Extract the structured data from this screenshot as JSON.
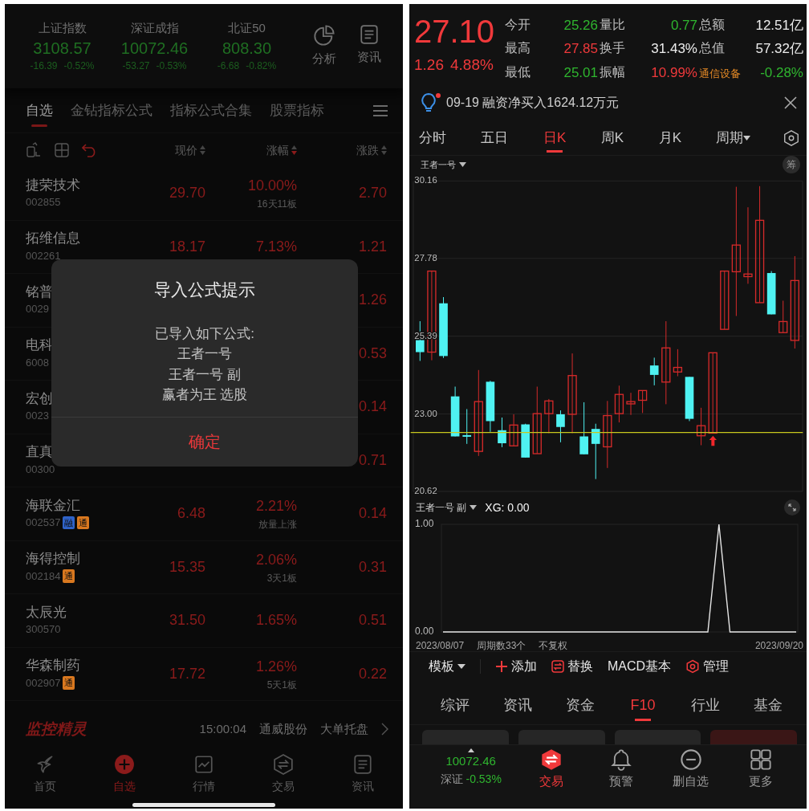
{
  "left_screen": {
    "indices": [
      {
        "name": "上证指数",
        "value": "3108.57",
        "change": "-16.39",
        "percent": "-0.52%"
      },
      {
        "name": "深证成指",
        "value": "10072.46",
        "change": "-53.27",
        "percent": "-0.53%"
      },
      {
        "name": "北证50",
        "value": "808.30",
        "change": "-6.68",
        "percent": "-0.82%"
      }
    ],
    "header_actions": [
      {
        "label": "分析",
        "kind": "pie"
      },
      {
        "label": "资讯",
        "kind": "doc"
      }
    ],
    "tabs": [
      {
        "label": "自选",
        "selected": true
      },
      {
        "label": "金钻指标公式",
        "selected": false
      },
      {
        "label": "指标公式合集",
        "selected": false
      },
      {
        "label": "股票指标",
        "selected": false
      }
    ],
    "columns": [
      {
        "label": "现价",
        "sorted": false
      },
      {
        "label": "涨幅",
        "sorted": true
      },
      {
        "label": "涨跌",
        "sorted": false
      }
    ],
    "stocks": [
      {
        "name": "捷荣技术",
        "code": "002855",
        "price": "29.70",
        "percent": "10.00%",
        "note": "16天11板",
        "change": "2.70"
      },
      {
        "name": "拓维信息",
        "code": "002261",
        "price": "18.17",
        "percent": "7.13%",
        "change": "1.21"
      },
      {
        "name": "铭普",
        "code": "0029",
        "change": "1.26"
      },
      {
        "name": "电科",
        "code": "6008",
        "change": "0.53"
      },
      {
        "name": "宏创",
        "code": "0023",
        "change": "0.14"
      },
      {
        "name": "直真",
        "code": "00300",
        "change": "0.71"
      },
      {
        "name": "海联金汇",
        "code": "002537",
        "tags": [
          {
            "text": "融",
            "color": "#2f63c9"
          },
          {
            "text": "通",
            "color": "#d9781f"
          }
        ],
        "price": "6.48",
        "percent": "2.21%",
        "note": "放量上涨",
        "change": "0.14"
      },
      {
        "name": "海得控制",
        "code": "002184",
        "tags": [
          {
            "text": "通",
            "color": "#d9781f"
          }
        ],
        "price": "15.35",
        "percent": "2.06%",
        "note": "3天1板",
        "change": "0.31"
      },
      {
        "name": "太辰光",
        "code": "300570",
        "price": "31.50",
        "percent": "1.65%",
        "change": "0.51"
      },
      {
        "name": "华森制药",
        "code": "002907",
        "tags": [
          {
            "text": "通",
            "color": "#d9781f"
          }
        ],
        "price": "17.72",
        "percent": "1.26%",
        "note": "5天1板",
        "change": "0.22"
      }
    ],
    "monitor": {
      "logo": "监控精灵",
      "time": "15:00:04",
      "stock": "通威股份",
      "event": "大单托盘"
    },
    "nav": [
      {
        "label": "首页",
        "kind": "home",
        "selected": false
      },
      {
        "label": "自选",
        "kind": "plus",
        "selected": true
      },
      {
        "label": "行情",
        "kind": "chart",
        "selected": false
      },
      {
        "label": "交易",
        "kind": "swap",
        "selected": false
      },
      {
        "label": "资讯",
        "kind": "doc",
        "selected": false
      }
    ]
  },
  "dialog": {
    "title": "导入公式提示",
    "lines": [
      "已导入如下公式:",
      "王者一号",
      "王者一号 副",
      "赢者为王 选股"
    ],
    "button": "确定"
  },
  "right_screen": {
    "quote": {
      "price": "27.10",
      "change": "1.26",
      "percent": "4.88%"
    },
    "stats": [
      {
        "label": "今开",
        "value": "25.26",
        "color": "#2fb52f"
      },
      {
        "label": "量比",
        "value": "0.77",
        "color": "#2fb52f"
      },
      {
        "label": "总额",
        "value": "12.51亿",
        "color": "#ececec"
      },
      {
        "label": "最高",
        "value": "27.85",
        "color": "#f0393b"
      },
      {
        "label": "换手",
        "value": "31.43%",
        "color": "#ececec"
      },
      {
        "label": "总值",
        "value": "57.32亿",
        "color": "#ececec"
      },
      {
        "label": "最低",
        "value": "25.01",
        "color": "#2fb52f"
      },
      {
        "label": "振幅",
        "value": "10.99%",
        "color": "#f0393b"
      },
      {
        "label": "通信设备",
        "value": "-0.28%",
        "color": "#2fb52f",
        "kind": "sector"
      }
    ],
    "notice": {
      "text": "09-19 融资净买入1624.12万元",
      "unread": true
    },
    "period_tabs": [
      {
        "label": "分时",
        "selected": false
      },
      {
        "label": "五日",
        "selected": false
      },
      {
        "label": "日K",
        "selected": true
      },
      {
        "label": "周K",
        "selected": false
      },
      {
        "label": "月K",
        "selected": false
      },
      {
        "label": "周期",
        "selected": false,
        "kind": "menu"
      }
    ],
    "main_indicator": "王者一号",
    "chips_button": "筹",
    "main_chart": {
      "chart_data": {
        "type": "candlestick",
        "grid": true,
        "ref_lines": [
          {
            "axis": "y",
            "value": 22.43,
            "color": "#c8c81e"
          }
        ],
        "ohlc": [
          [
            25.27,
            25.85,
            24.63,
            24.9
          ],
          [
            24.9,
            27.39,
            24.65,
            27.39
          ],
          [
            26.4,
            26.59,
            24.72,
            24.78
          ],
          [
            23.54,
            23.84,
            22.31,
            22.31
          ],
          [
            22.35,
            23.15,
            22.08,
            22.3
          ],
          [
            21.85,
            24.35,
            21.71,
            23.38
          ],
          [
            23.99,
            24.02,
            22.45,
            22.78
          ],
          [
            22.5,
            22.89,
            21.98,
            22.1
          ],
          [
            22.02,
            22.99,
            22.02,
            22.66
          ],
          [
            22.68,
            22.7,
            21.66,
            21.66
          ],
          [
            21.78,
            23.84,
            21.78,
            23.01
          ],
          [
            23.01,
            23.46,
            22.41,
            23.4
          ],
          [
            22.99,
            23.11,
            22.13,
            22.6
          ],
          [
            22.99,
            24.86,
            22.41,
            24.18
          ],
          [
            22.31,
            23.36,
            21.76,
            21.76
          ],
          [
            22.54,
            22.7,
            21.0,
            22.08
          ],
          [
            21.99,
            23.4,
            21.34,
            22.95
          ],
          [
            23.01,
            23.87,
            22.74,
            23.6
          ],
          [
            23.31,
            23.65,
            22.97,
            23.38
          ],
          [
            23.42,
            23.72,
            23.03,
            23.72
          ],
          [
            24.49,
            24.73,
            23.88,
            24.2
          ],
          [
            23.98,
            25.85,
            23.3,
            25.03
          ],
          [
            24.29,
            24.99,
            24.16,
            24.43
          ],
          [
            24.14,
            24.14,
            22.78,
            22.85
          ],
          [
            22.33,
            23.19,
            22.04,
            22.64
          ],
          [
            22.41,
            24.88,
            22.41,
            24.88
          ],
          [
            25.6,
            27.39,
            25.6,
            27.39
          ],
          [
            27.37,
            29.98,
            26.01,
            28.19
          ],
          [
            27.22,
            29.35,
            27.0,
            27.3
          ],
          [
            26.42,
            30.0,
            26.42,
            28.95
          ],
          [
            27.33,
            27.39,
            26.06,
            26.06
          ],
          [
            25.5,
            26.48,
            25.5,
            25.84
          ],
          [
            25.26,
            27.85,
            25.01,
            27.1
          ]
        ],
        "ylim": [
          20.62,
          30.16
        ],
        "yticks": [
          {
            "value": 30.16,
            "label": "30.16"
          },
          {
            "value": 27.78,
            "label": "27.78"
          },
          {
            "value": 25.39,
            "label": "25.39"
          },
          {
            "value": 23,
            "label": "23.00"
          },
          {
            "value": 20.62,
            "label": "20.62"
          }
        ]
      }
    },
    "sub_indicator": {
      "name": "王者一号 副",
      "reading": "XG: 0.00",
      "chart_data": {
        "type": "line",
        "series": [
          {
            "color": "#e6e6e6",
            "values": [
              0,
              0,
              0,
              0,
              0,
              0,
              0,
              0,
              0,
              0,
              0,
              0,
              0,
              0,
              0,
              0,
              0,
              0,
              0,
              0,
              0,
              0,
              0,
              0,
              0,
              1,
              0,
              0,
              0,
              0,
              0,
              0,
              0
            ]
          }
        ],
        "ylim": [
          0,
          1
        ],
        "yticks": [
          {
            "value": 1,
            "label": "1.00"
          },
          {
            "value": 0,
            "label": "0.00"
          }
        ]
      }
    },
    "start_date": "2023/08/07",
    "periods": "周期数33个",
    "adjust": "不复权",
    "end_date": "2023/09/20",
    "toolbar": [
      {
        "label": "模板",
        "kind": "dropdown"
      },
      {
        "label": "添加",
        "kind": "add"
      },
      {
        "label": "替换",
        "kind": "swap"
      },
      {
        "label": "MACD基本",
        "kind": "plain"
      },
      {
        "label": "管理",
        "kind": "manage"
      }
    ],
    "info_tabs": [
      {
        "label": "综评",
        "selected": false
      },
      {
        "label": "资讯",
        "selected": false
      },
      {
        "label": "资金",
        "selected": false
      },
      {
        "label": "F10",
        "selected": true
      },
      {
        "label": "行业",
        "selected": false
      },
      {
        "label": "基金",
        "selected": false
      }
    ],
    "bottom_index": {
      "value": "10072.46",
      "name": "深证",
      "percent": "-0.53%"
    },
    "bottom_nav": [
      {
        "label": "交易",
        "kind": "trade",
        "selected": true
      },
      {
        "label": "预警",
        "kind": "bell",
        "selected": false
      },
      {
        "label": "删自选",
        "kind": "remove",
        "selected": false
      },
      {
        "label": "更多",
        "kind": "grid",
        "selected": false
      }
    ]
  }
}
